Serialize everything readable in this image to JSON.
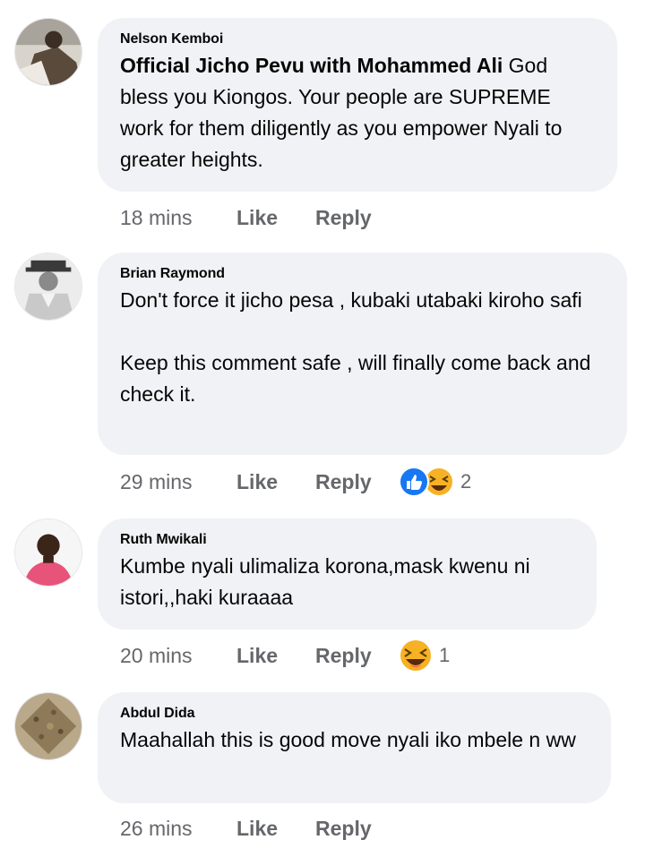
{
  "comments": [
    {
      "author": "Nelson Kemboi",
      "tag": "Official Jicho Pevu with Mohammed Ali",
      "text": " God bless you Kiongos. Your people are SUPREME work for them diligently as you empower Nyali to greater heights.",
      "time": "18 mins",
      "like": "Like",
      "reply": "Reply"
    },
    {
      "author": "Brian Raymond",
      "text": "Don't force it jicho pesa , kubaki utabaki kiroho safi\n\nKeep this comment safe , will finally come back and check it.",
      "time": "29 mins",
      "like": "Like",
      "reply": "Reply",
      "reactions": [
        "like-reaction-icon",
        "haha-reaction-icon"
      ],
      "reaction_count": "2"
    },
    {
      "author": "Ruth Mwikali",
      "text": "Kumbe nyali ulimaliza korona,mask kwenu ni istori,,haki kuraaaa",
      "time": "20 mins",
      "like": "Like",
      "reply": "Reply",
      "reactions": [
        "haha-reaction-icon"
      ],
      "reaction_count": "1"
    },
    {
      "author": "Abdul Dida",
      "text": "Maahallah this is good move nyali iko mbele n ww",
      "time": "26 mins",
      "like": "Like",
      "reply": "Reply"
    }
  ],
  "colors": {
    "bubble": "#f0f2f5",
    "text": "#050505",
    "meta": "#65676b",
    "like_reaction": "#1877f2",
    "haha_reaction": "#f7b125"
  }
}
